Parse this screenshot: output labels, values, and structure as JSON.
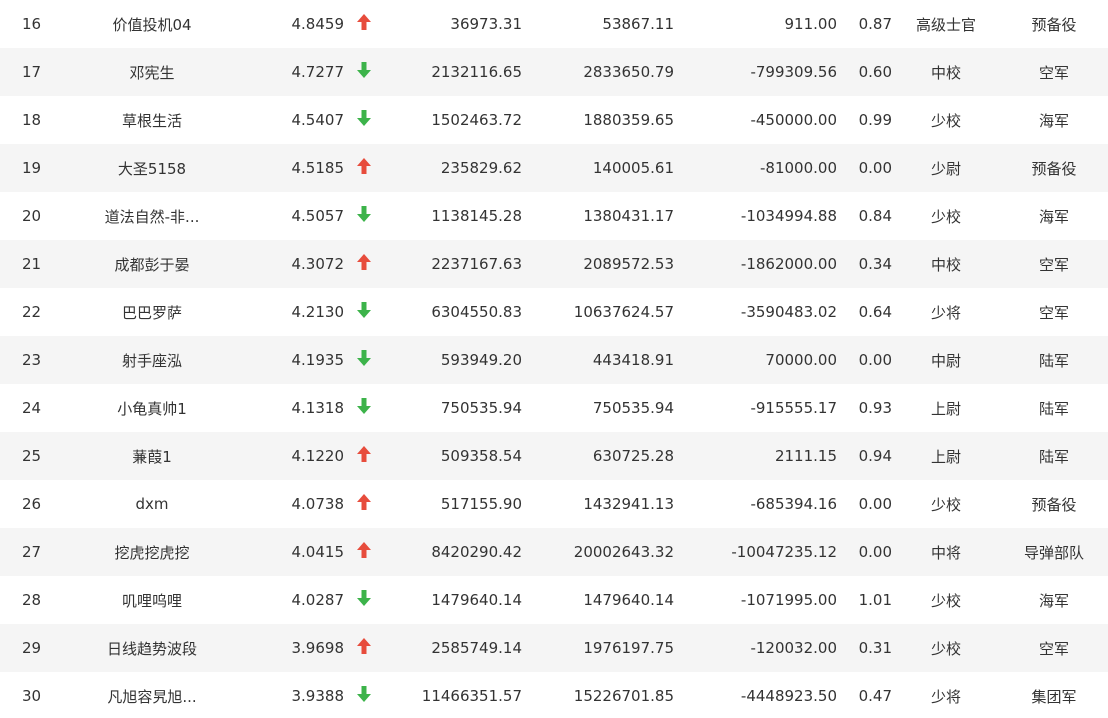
{
  "colors": {
    "up": "#e74c3c",
    "down": "#3cb34a",
    "stripe": "#f5f5f5",
    "text": "#333333"
  },
  "rows": [
    {
      "rank": "16",
      "name": "价值投机04",
      "score": "4.8459",
      "trend": "up",
      "value1": "36973.31",
      "value2": "53867.11",
      "value3": "911.00",
      "ratio": "0.87",
      "military_rank": "高级士官",
      "branch": "预备役"
    },
    {
      "rank": "17",
      "name": "邓宪生",
      "score": "4.7277",
      "trend": "down",
      "value1": "2132116.65",
      "value2": "2833650.79",
      "value3": "-799309.56",
      "ratio": "0.60",
      "military_rank": "中校",
      "branch": "空军"
    },
    {
      "rank": "18",
      "name": "草根生活",
      "score": "4.5407",
      "trend": "down",
      "value1": "1502463.72",
      "value2": "1880359.65",
      "value3": "-450000.00",
      "ratio": "0.99",
      "military_rank": "少校",
      "branch": "海军"
    },
    {
      "rank": "19",
      "name": "大圣5158",
      "score": "4.5185",
      "trend": "up",
      "value1": "235829.62",
      "value2": "140005.61",
      "value3": "-81000.00",
      "ratio": "0.00",
      "military_rank": "少尉",
      "branch": "预备役"
    },
    {
      "rank": "20",
      "name": "道法自然-非...",
      "score": "4.5057",
      "trend": "down",
      "value1": "1138145.28",
      "value2": "1380431.17",
      "value3": "-1034994.88",
      "ratio": "0.84",
      "military_rank": "少校",
      "branch": "海军"
    },
    {
      "rank": "21",
      "name": "成都彭于晏",
      "score": "4.3072",
      "trend": "up",
      "value1": "2237167.63",
      "value2": "2089572.53",
      "value3": "-1862000.00",
      "ratio": "0.34",
      "military_rank": "中校",
      "branch": "空军"
    },
    {
      "rank": "22",
      "name": "巴巴罗萨",
      "score": "4.2130",
      "trend": "down",
      "value1": "6304550.83",
      "value2": "10637624.57",
      "value3": "-3590483.02",
      "ratio": "0.64",
      "military_rank": "少将",
      "branch": "空军"
    },
    {
      "rank": "23",
      "name": "射手座泓",
      "score": "4.1935",
      "trend": "down",
      "value1": "593949.20",
      "value2": "443418.91",
      "value3": "70000.00",
      "ratio": "0.00",
      "military_rank": "中尉",
      "branch": "陆军"
    },
    {
      "rank": "24",
      "name": "小龟真帅1",
      "score": "4.1318",
      "trend": "down",
      "value1": "750535.94",
      "value2": "750535.94",
      "value3": "-915555.17",
      "ratio": "0.93",
      "military_rank": "上尉",
      "branch": "陆军"
    },
    {
      "rank": "25",
      "name": "蒹葭1",
      "score": "4.1220",
      "trend": "up",
      "value1": "509358.54",
      "value2": "630725.28",
      "value3": "2111.15",
      "ratio": "0.94",
      "military_rank": "上尉",
      "branch": "陆军"
    },
    {
      "rank": "26",
      "name": "dxm",
      "score": "4.0738",
      "trend": "up",
      "value1": "517155.90",
      "value2": "1432941.13",
      "value3": "-685394.16",
      "ratio": "0.00",
      "military_rank": "少校",
      "branch": "预备役"
    },
    {
      "rank": "27",
      "name": "挖虎挖虎挖",
      "score": "4.0415",
      "trend": "up",
      "value1": "8420290.42",
      "value2": "20002643.32",
      "value3": "-10047235.12",
      "ratio": "0.00",
      "military_rank": "中将",
      "branch": "导弹部队"
    },
    {
      "rank": "28",
      "name": "叽哩呜哩",
      "score": "4.0287",
      "trend": "down",
      "value1": "1479640.14",
      "value2": "1479640.14",
      "value3": "-1071995.00",
      "ratio": "1.01",
      "military_rank": "少校",
      "branch": "海军"
    },
    {
      "rank": "29",
      "name": "日线趋势波段",
      "score": "3.9698",
      "trend": "up",
      "value1": "2585749.14",
      "value2": "1976197.75",
      "value3": "-120032.00",
      "ratio": "0.31",
      "military_rank": "少校",
      "branch": "空军"
    },
    {
      "rank": "30",
      "name": "凡旭容旯旭...",
      "score": "3.9388",
      "trend": "down",
      "value1": "11466351.57",
      "value2": "15226701.85",
      "value3": "-4448923.50",
      "ratio": "0.47",
      "military_rank": "少将",
      "branch": "集团军"
    }
  ]
}
